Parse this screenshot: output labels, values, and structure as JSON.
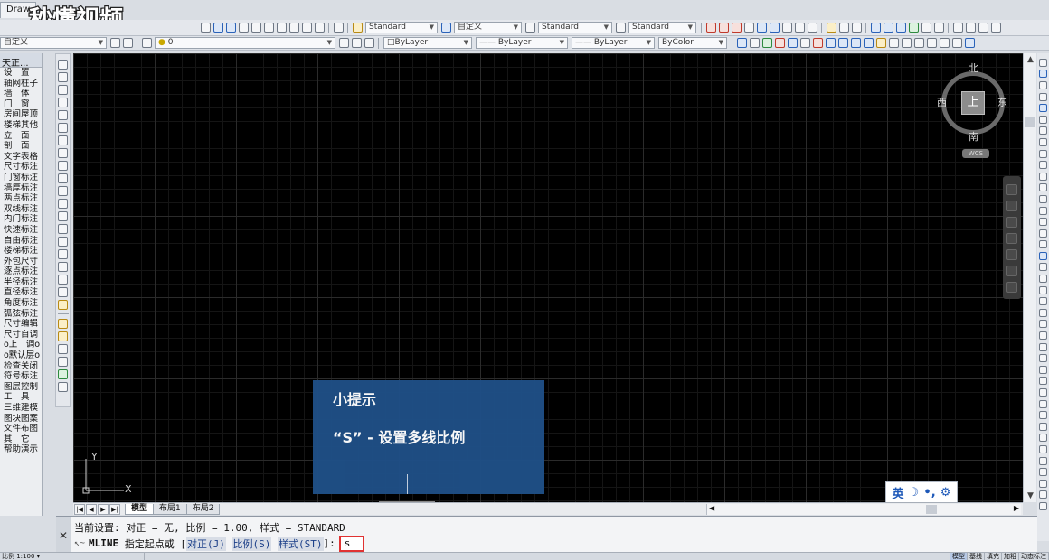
{
  "window": {
    "tab_label": "Draw"
  },
  "watermark": {
    "text": "秒懂视频"
  },
  "toolbar1": {
    "text_style": "Standard",
    "dim_style": "自定义",
    "table_style": "Standard",
    "mleader_style": "Standard"
  },
  "toolbar2": {
    "workspace": "自定义",
    "layer": "0",
    "color": "ByLayer",
    "linetype": "ByLayer",
    "lineweight": "ByLayer",
    "plotstyle": "ByColor"
  },
  "side_menu": {
    "title": "天正...",
    "items": [
      "设　置",
      "轴网柱子",
      "墙　体",
      "门　窗",
      "房间屋顶",
      "楼梯其他",
      "立　面",
      "剖　面",
      "文字表格",
      "尺寸标注",
      "门窗标注",
      "墙厚标注",
      "两点标注",
      "双线标注",
      "内门标注",
      "快速标注",
      "自由标注",
      "楼梯标注",
      "外包尺寸",
      "逐点标注",
      "半径标注",
      "直径标注",
      "角度标注",
      "弧弦标注",
      "尺寸编辑",
      "尺寸自调",
      "o上　调o",
      "o默认层o",
      "检查关闭",
      "符号标注",
      "图层控制",
      "工　具",
      "三维建模",
      "图块图案",
      "文件布图",
      "其　它",
      "帮助演示"
    ]
  },
  "viewcube": {
    "north": "北",
    "south": "南",
    "east": "东",
    "west": "西",
    "top": "上",
    "wcs": "WCS"
  },
  "ucs": {
    "y": "Y",
    "x": "X"
  },
  "tip": {
    "title": "小提示",
    "body": "“S” - 设置多线比例"
  },
  "ime": {
    "lang": "英",
    "moon": "☽",
    "dot": "•,",
    "gear": "⚙"
  },
  "layout_tabs": [
    "模型",
    "布局1",
    "布局2"
  ],
  "command": {
    "history": "当前设置: 对正 = 无, 比例 = 1.00, 样式 = STANDARD",
    "cmd_name": "MLINE",
    "prompt": "指定起点或 [",
    "opt1": "对正(J)",
    "opt2": "比例(S)",
    "opt3": "样式(ST)",
    "end": "]:",
    "input_value": "s"
  },
  "status": {
    "scale": "比例 1:100 ▾",
    "right_buttons": [
      "模型",
      "基线",
      "填充",
      "加粗",
      "动态标注"
    ]
  }
}
